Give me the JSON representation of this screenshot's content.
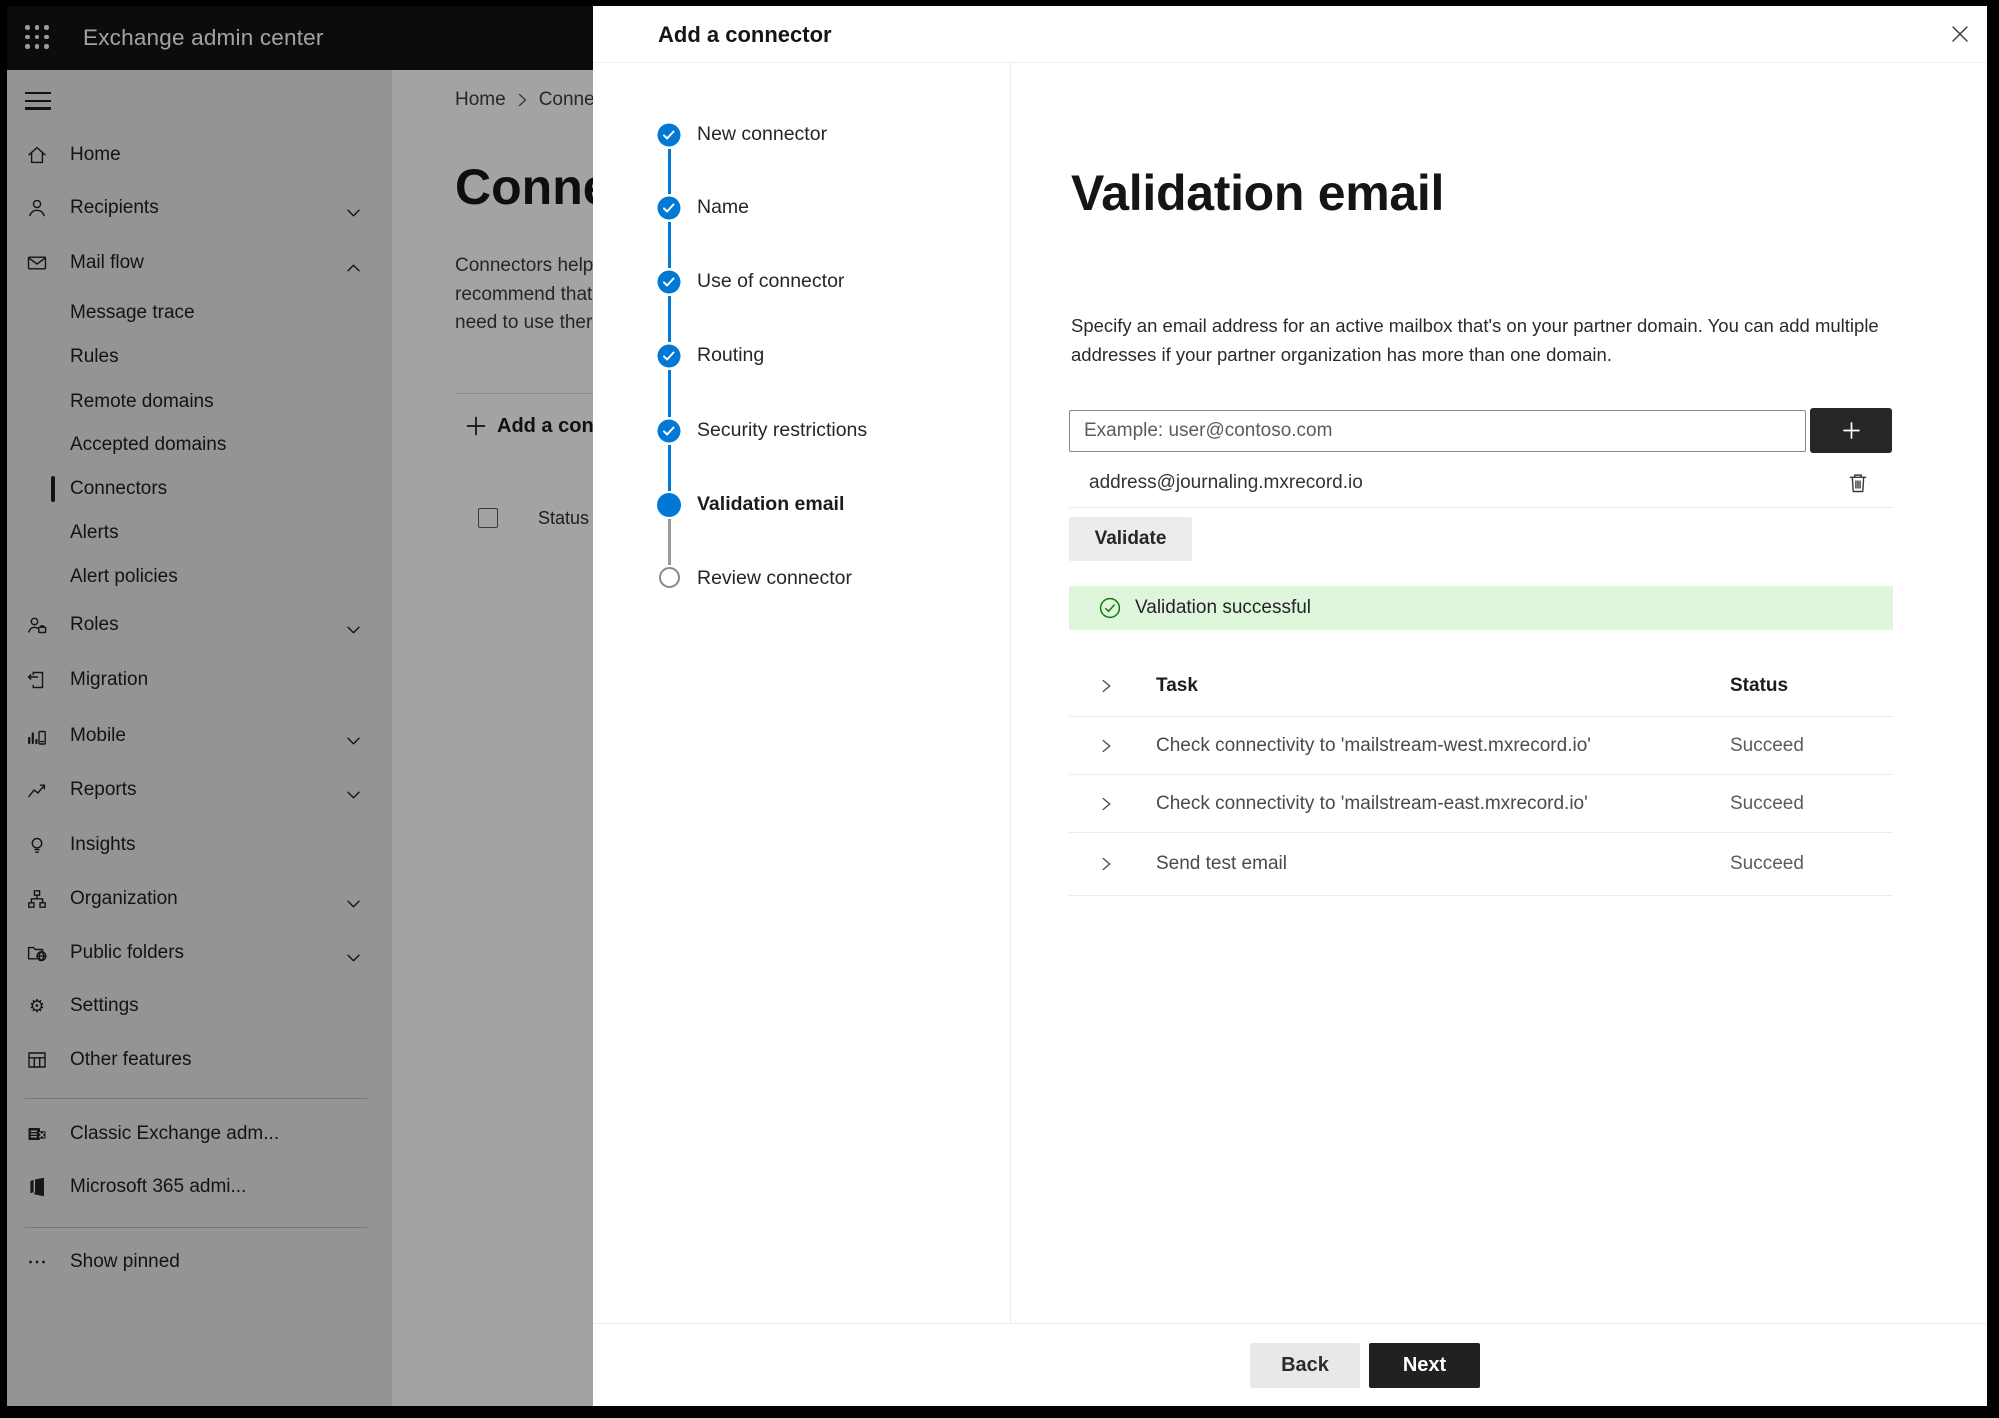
{
  "app": {
    "topbar": {
      "title": "Exchange admin center"
    }
  },
  "sidebar": {
    "items": [
      {
        "label": "Home",
        "icon": "home-icon"
      },
      {
        "label": "Recipients",
        "icon": "person-icon",
        "chevron": "down"
      },
      {
        "label": "Mail flow",
        "icon": "mail-icon",
        "chevron": "up"
      },
      {
        "label": "Message trace",
        "indent": true
      },
      {
        "label": "Rules",
        "indent": true
      },
      {
        "label": "Remote domains",
        "indent": true
      },
      {
        "label": "Accepted domains",
        "indent": true
      },
      {
        "label": "Connectors",
        "indent": true,
        "selected": true
      },
      {
        "label": "Alerts",
        "indent": true
      },
      {
        "label": "Alert policies",
        "indent": true
      },
      {
        "label": "Roles",
        "icon": "roles-icon",
        "chevron": "down"
      },
      {
        "label": "Migration",
        "icon": "migration-icon"
      },
      {
        "label": "Mobile",
        "icon": "mobile-icon",
        "chevron": "down"
      },
      {
        "label": "Reports",
        "icon": "reports-icon",
        "chevron": "down"
      },
      {
        "label": "Insights",
        "icon": "insights-icon"
      },
      {
        "label": "Organization",
        "icon": "organization-icon",
        "chevron": "down"
      },
      {
        "label": "Public folders",
        "icon": "public-folders-icon",
        "chevron": "down"
      },
      {
        "label": "Settings",
        "icon": "settings-icon"
      },
      {
        "label": "Other features",
        "icon": "other-features-icon"
      },
      {
        "divider": true
      },
      {
        "label": "Classic Exchange adm...",
        "icon": "classic-exchange-icon"
      },
      {
        "label": "Microsoft 365 admi...",
        "icon": "m365-icon"
      },
      {
        "divider": true
      },
      {
        "label": "Show pinned",
        "icon": "more-icon"
      }
    ]
  },
  "page": {
    "breadcrumb": {
      "home": "Home",
      "current": "Connectors"
    },
    "title": "Connectors",
    "intro_lines": [
      "Connectors help",
      "recommend that",
      "need to use ther"
    ],
    "add_button": "Add a connector",
    "status_header": "Status"
  },
  "wizard": {
    "title": "Add a connector",
    "steps": [
      {
        "label": "New connector",
        "state": "done"
      },
      {
        "label": "Name",
        "state": "done"
      },
      {
        "label": "Use of connector",
        "state": "done"
      },
      {
        "label": "Routing",
        "state": "done"
      },
      {
        "label": "Security restrictions",
        "state": "done"
      },
      {
        "label": "Validation email",
        "state": "current"
      },
      {
        "label": "Review connector",
        "state": "upcoming"
      }
    ],
    "content": {
      "heading": "Validation email",
      "description": "Specify an email address for an active mailbox that's on your partner domain. You can add multiple addresses if your partner organization has more than one domain.",
      "email_placeholder": "Example: user@contoso.com",
      "email_value": "",
      "added_address": "address@journaling.mxrecord.io",
      "validate_label": "Validate",
      "success_message": "Validation successful",
      "results_table": {
        "task_header": "Task",
        "status_header": "Status",
        "rows": [
          {
            "task": "Check connectivity to 'mailstream-west.mxrecord.io'",
            "status": "Succeed"
          },
          {
            "task": "Check connectivity to 'mailstream-east.mxrecord.io'",
            "status": "Succeed"
          },
          {
            "task": "Send test email",
            "status": "Succeed"
          }
        ]
      }
    },
    "footer": {
      "back_label": "Back",
      "next_label": "Next"
    }
  },
  "colors": {
    "accent": "#0078d4",
    "success_green": "#107c10",
    "success_bg": "#dff6dd",
    "topbar_bg": "#141414"
  }
}
